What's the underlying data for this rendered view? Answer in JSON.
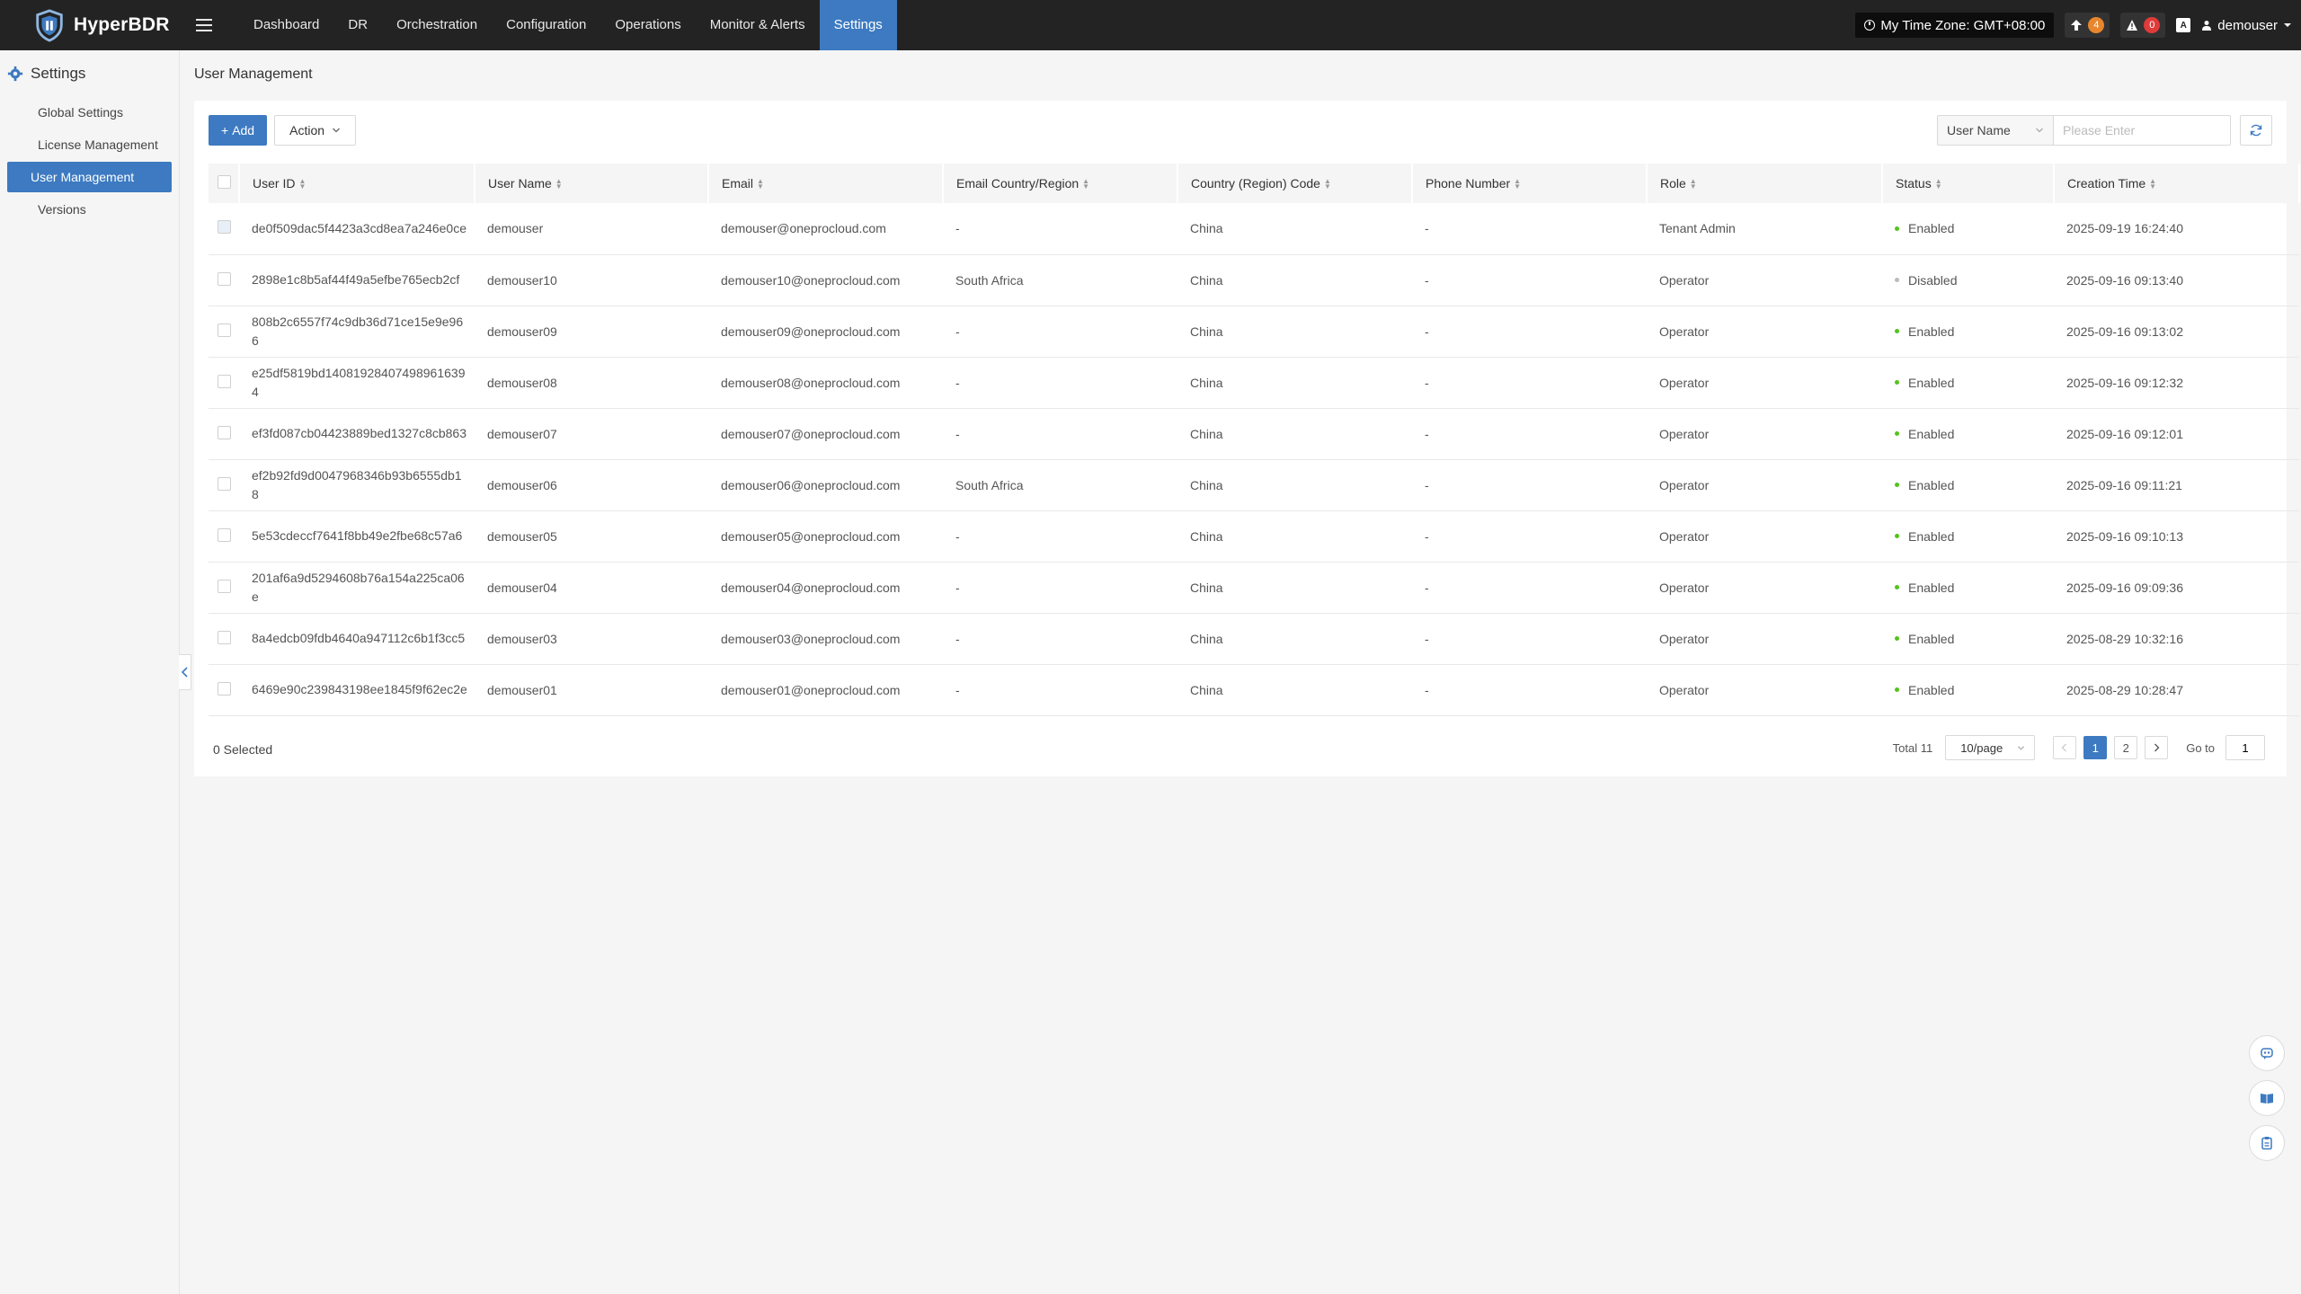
{
  "app": {
    "name": "HyperBDR"
  },
  "nav": {
    "items": [
      {
        "label": "Dashboard",
        "active": false
      },
      {
        "label": "DR",
        "active": false
      },
      {
        "label": "Orchestration",
        "active": false
      },
      {
        "label": "Configuration",
        "active": false
      },
      {
        "label": "Operations",
        "active": false
      },
      {
        "label": "Monitor & Alerts",
        "active": false
      },
      {
        "label": "Settings",
        "active": true
      }
    ]
  },
  "header_right": {
    "timezone": "My Time Zone: GMT+08:00",
    "upgrade_count": "4",
    "alert_count": "0",
    "language_icon": "A",
    "username": "demouser"
  },
  "sidebar": {
    "title": "Settings",
    "items": [
      {
        "label": "Global Settings",
        "active": false
      },
      {
        "label": "License Management",
        "active": false
      },
      {
        "label": "User Management",
        "active": true
      },
      {
        "label": "Versions",
        "active": false
      }
    ]
  },
  "page": {
    "title": "User Management"
  },
  "toolbar": {
    "add_label": "Add",
    "action_label": "Action"
  },
  "search": {
    "field_label": "User Name",
    "placeholder": "Please Enter"
  },
  "table": {
    "columns": [
      "User ID",
      "User Name",
      "Email",
      "Email Country/Region",
      "Country (Region) Code",
      "Phone Number",
      "Role",
      "Status",
      "Creation Time"
    ],
    "rows": [
      {
        "id": "de0f509dac5f4423a3cd8ea7a246e0ce",
        "name": "demouser",
        "email": "demouser@oneprocloud.com",
        "email_region": "-",
        "country": "China",
        "phone": "-",
        "role": "Tenant Admin",
        "status": "Enabled",
        "created": "2025-09-19 16:24:40"
      },
      {
        "id": "2898e1c8b5af44f49a5efbe765ecb2cf",
        "name": "demouser10",
        "email": "demouser10@oneprocloud.com",
        "email_region": "South Africa",
        "country": "China",
        "phone": "-",
        "role": "Operator",
        "status": "Disabled",
        "created": "2025-09-16 09:13:40"
      },
      {
        "id": "808b2c6557f74c9db36d71ce15e9e966",
        "name": "demouser09",
        "email": "demouser09@oneprocloud.com",
        "email_region": "-",
        "country": "China",
        "phone": "-",
        "role": "Operator",
        "status": "Enabled",
        "created": "2025-09-16 09:13:02"
      },
      {
        "id": "e25df5819bd140819284074989616394",
        "name": "demouser08",
        "email": "demouser08@oneprocloud.com",
        "email_region": "-",
        "country": "China",
        "phone": "-",
        "role": "Operator",
        "status": "Enabled",
        "created": "2025-09-16 09:12:32"
      },
      {
        "id": "ef3fd087cb04423889bed1327c8cb863",
        "name": "demouser07",
        "email": "demouser07@oneprocloud.com",
        "email_region": "-",
        "country": "China",
        "phone": "-",
        "role": "Operator",
        "status": "Enabled",
        "created": "2025-09-16 09:12:01"
      },
      {
        "id": "ef2b92fd9d0047968346b93b6555db18",
        "name": "demouser06",
        "email": "demouser06@oneprocloud.com",
        "email_region": "South Africa",
        "country": "China",
        "phone": "-",
        "role": "Operator",
        "status": "Enabled",
        "created": "2025-09-16 09:11:21"
      },
      {
        "id": "5e53cdeccf7641f8bb49e2fbe68c57a6",
        "name": "demouser05",
        "email": "demouser05@oneprocloud.com",
        "email_region": "-",
        "country": "China",
        "phone": "-",
        "role": "Operator",
        "status": "Enabled",
        "created": "2025-09-16 09:10:13"
      },
      {
        "id": "201af6a9d5294608b76a154a225ca06e",
        "name": "demouser04",
        "email": "demouser04@oneprocloud.com",
        "email_region": "-",
        "country": "China",
        "phone": "-",
        "role": "Operator",
        "status": "Enabled",
        "created": "2025-09-16 09:09:36"
      },
      {
        "id": "8a4edcb09fdb4640a947112c6b1f3cc5",
        "name": "demouser03",
        "email": "demouser03@oneprocloud.com",
        "email_region": "-",
        "country": "China",
        "phone": "-",
        "role": "Operator",
        "status": "Enabled",
        "created": "2025-08-29 10:32:16"
      },
      {
        "id": "6469e90c239843198ee1845f9f62ec2e",
        "name": "demouser01",
        "email": "demouser01@oneprocloud.com",
        "email_region": "-",
        "country": "China",
        "phone": "-",
        "role": "Operator",
        "status": "Enabled",
        "created": "2025-08-29 10:28:47"
      }
    ]
  },
  "footer": {
    "selected_text": "0 Selected",
    "total_text": "Total 11",
    "page_size": "10/page",
    "pages": [
      "1",
      "2"
    ],
    "current_page": "1",
    "goto_label": "Go to",
    "goto_value": "1"
  },
  "colors": {
    "accent": "#3d7ac1",
    "topbar": "#232323",
    "enabled": "#52c41a",
    "disabled": "#bbbbbb",
    "badge_orange": "#e8862e",
    "badge_red": "#e03a3a"
  },
  "icons": [
    "shield-logo-icon",
    "hamburger-icon",
    "clock-icon",
    "upgrade-arrow-icon",
    "warning-icon",
    "language-icon",
    "user-icon",
    "gear-icon",
    "chevron-down-icon",
    "refresh-icon",
    "sort-icon",
    "chevron-left-icon",
    "chevron-right-icon",
    "chat-bot-icon",
    "book-icon",
    "clipboard-icon"
  ]
}
